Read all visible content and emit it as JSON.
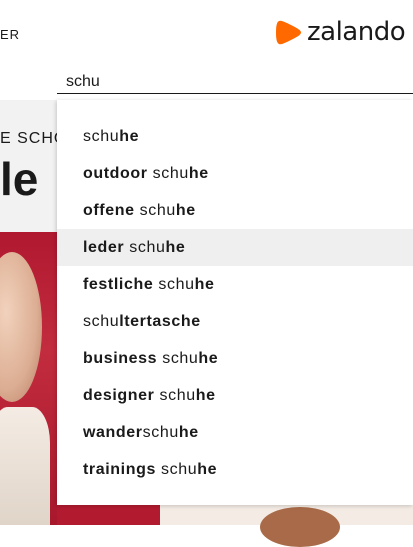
{
  "header": {
    "nav_fragment": "ER",
    "logo_text": "zalando",
    "logo_color": "#ff6900"
  },
  "search": {
    "value": "schu"
  },
  "promo": {
    "subtitle_fragment": "E SCHÖ",
    "title_fragment": "le"
  },
  "suggestions": [
    {
      "parts": [
        {
          "t": "schu",
          "b": false
        },
        {
          "t": "he",
          "b": true
        }
      ]
    },
    {
      "parts": [
        {
          "t": "outdoor",
          "b": true
        },
        {
          "t": " schu",
          "b": false
        },
        {
          "t": "he",
          "b": true
        }
      ]
    },
    {
      "parts": [
        {
          "t": "offene",
          "b": true
        },
        {
          "t": " schu",
          "b": false
        },
        {
          "t": "he",
          "b": true
        }
      ]
    },
    {
      "parts": [
        {
          "t": "leder",
          "b": true
        },
        {
          "t": " schu",
          "b": false
        },
        {
          "t": "he",
          "b": true
        }
      ],
      "hovered": true
    },
    {
      "parts": [
        {
          "t": "festliche",
          "b": true
        },
        {
          "t": " schu",
          "b": false
        },
        {
          "t": "he",
          "b": true
        }
      ]
    },
    {
      "parts": [
        {
          "t": "schu",
          "b": false
        },
        {
          "t": "ltertasche",
          "b": true
        }
      ]
    },
    {
      "parts": [
        {
          "t": "business",
          "b": true
        },
        {
          "t": " schu",
          "b": false
        },
        {
          "t": "he",
          "b": true
        }
      ]
    },
    {
      "parts": [
        {
          "t": "designer",
          "b": true
        },
        {
          "t": " schu",
          "b": false
        },
        {
          "t": "he",
          "b": true
        }
      ]
    },
    {
      "parts": [
        {
          "t": "wander",
          "b": true
        },
        {
          "t": "schu",
          "b": false
        },
        {
          "t": "he",
          "b": true
        }
      ]
    },
    {
      "parts": [
        {
          "t": "trainings",
          "b": true
        },
        {
          "t": " schu",
          "b": false
        },
        {
          "t": "he",
          "b": true
        }
      ]
    }
  ]
}
